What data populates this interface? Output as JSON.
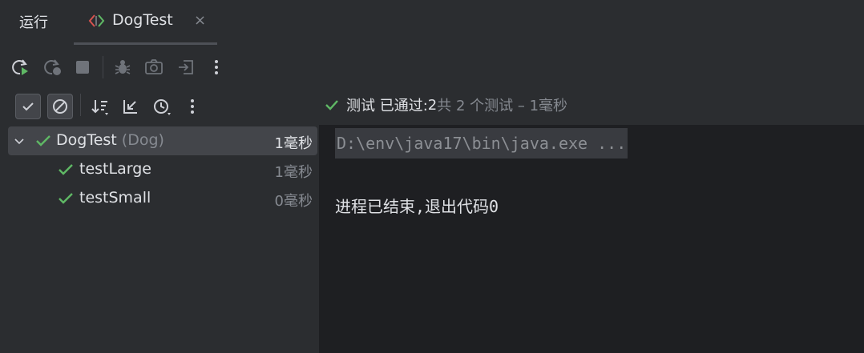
{
  "tabbar": {
    "run_label": "运行",
    "tab_title": "DogTest",
    "close_glyph": "×"
  },
  "toolbar": {
    "icons": [
      "rerun-icon",
      "rerun-failed-icon",
      "stop-icon",
      "debug-icon",
      "screenshot-icon",
      "exit-icon",
      "more-vertical-icon"
    ]
  },
  "test_toolbar": {
    "icons": [
      "show-passed-icon",
      "show-ignored-icon",
      "sort-icon",
      "collapse-icon",
      "history-icon",
      "more-vertical-icon"
    ]
  },
  "status": {
    "prefix": "测试 已通过: ",
    "count": "2",
    "rest": "共 2 个测试 – 1毫秒"
  },
  "tree": {
    "root": {
      "name": "DogTest",
      "sub": "(Dog)",
      "time": "1毫秒"
    },
    "children": [
      {
        "name": "testLarge",
        "time": "1毫秒"
      },
      {
        "name": "testSmall",
        "time": "0毫秒"
      }
    ]
  },
  "console": {
    "command": "D:\\env\\java17\\bin\\java.exe ...",
    "exit_message": "进程已结束,退出代码0"
  },
  "colors": {
    "pass_green": "#5fb865",
    "run_green": "#5fb865",
    "background": "#2b2d30",
    "console_bg": "#1e1f22"
  }
}
